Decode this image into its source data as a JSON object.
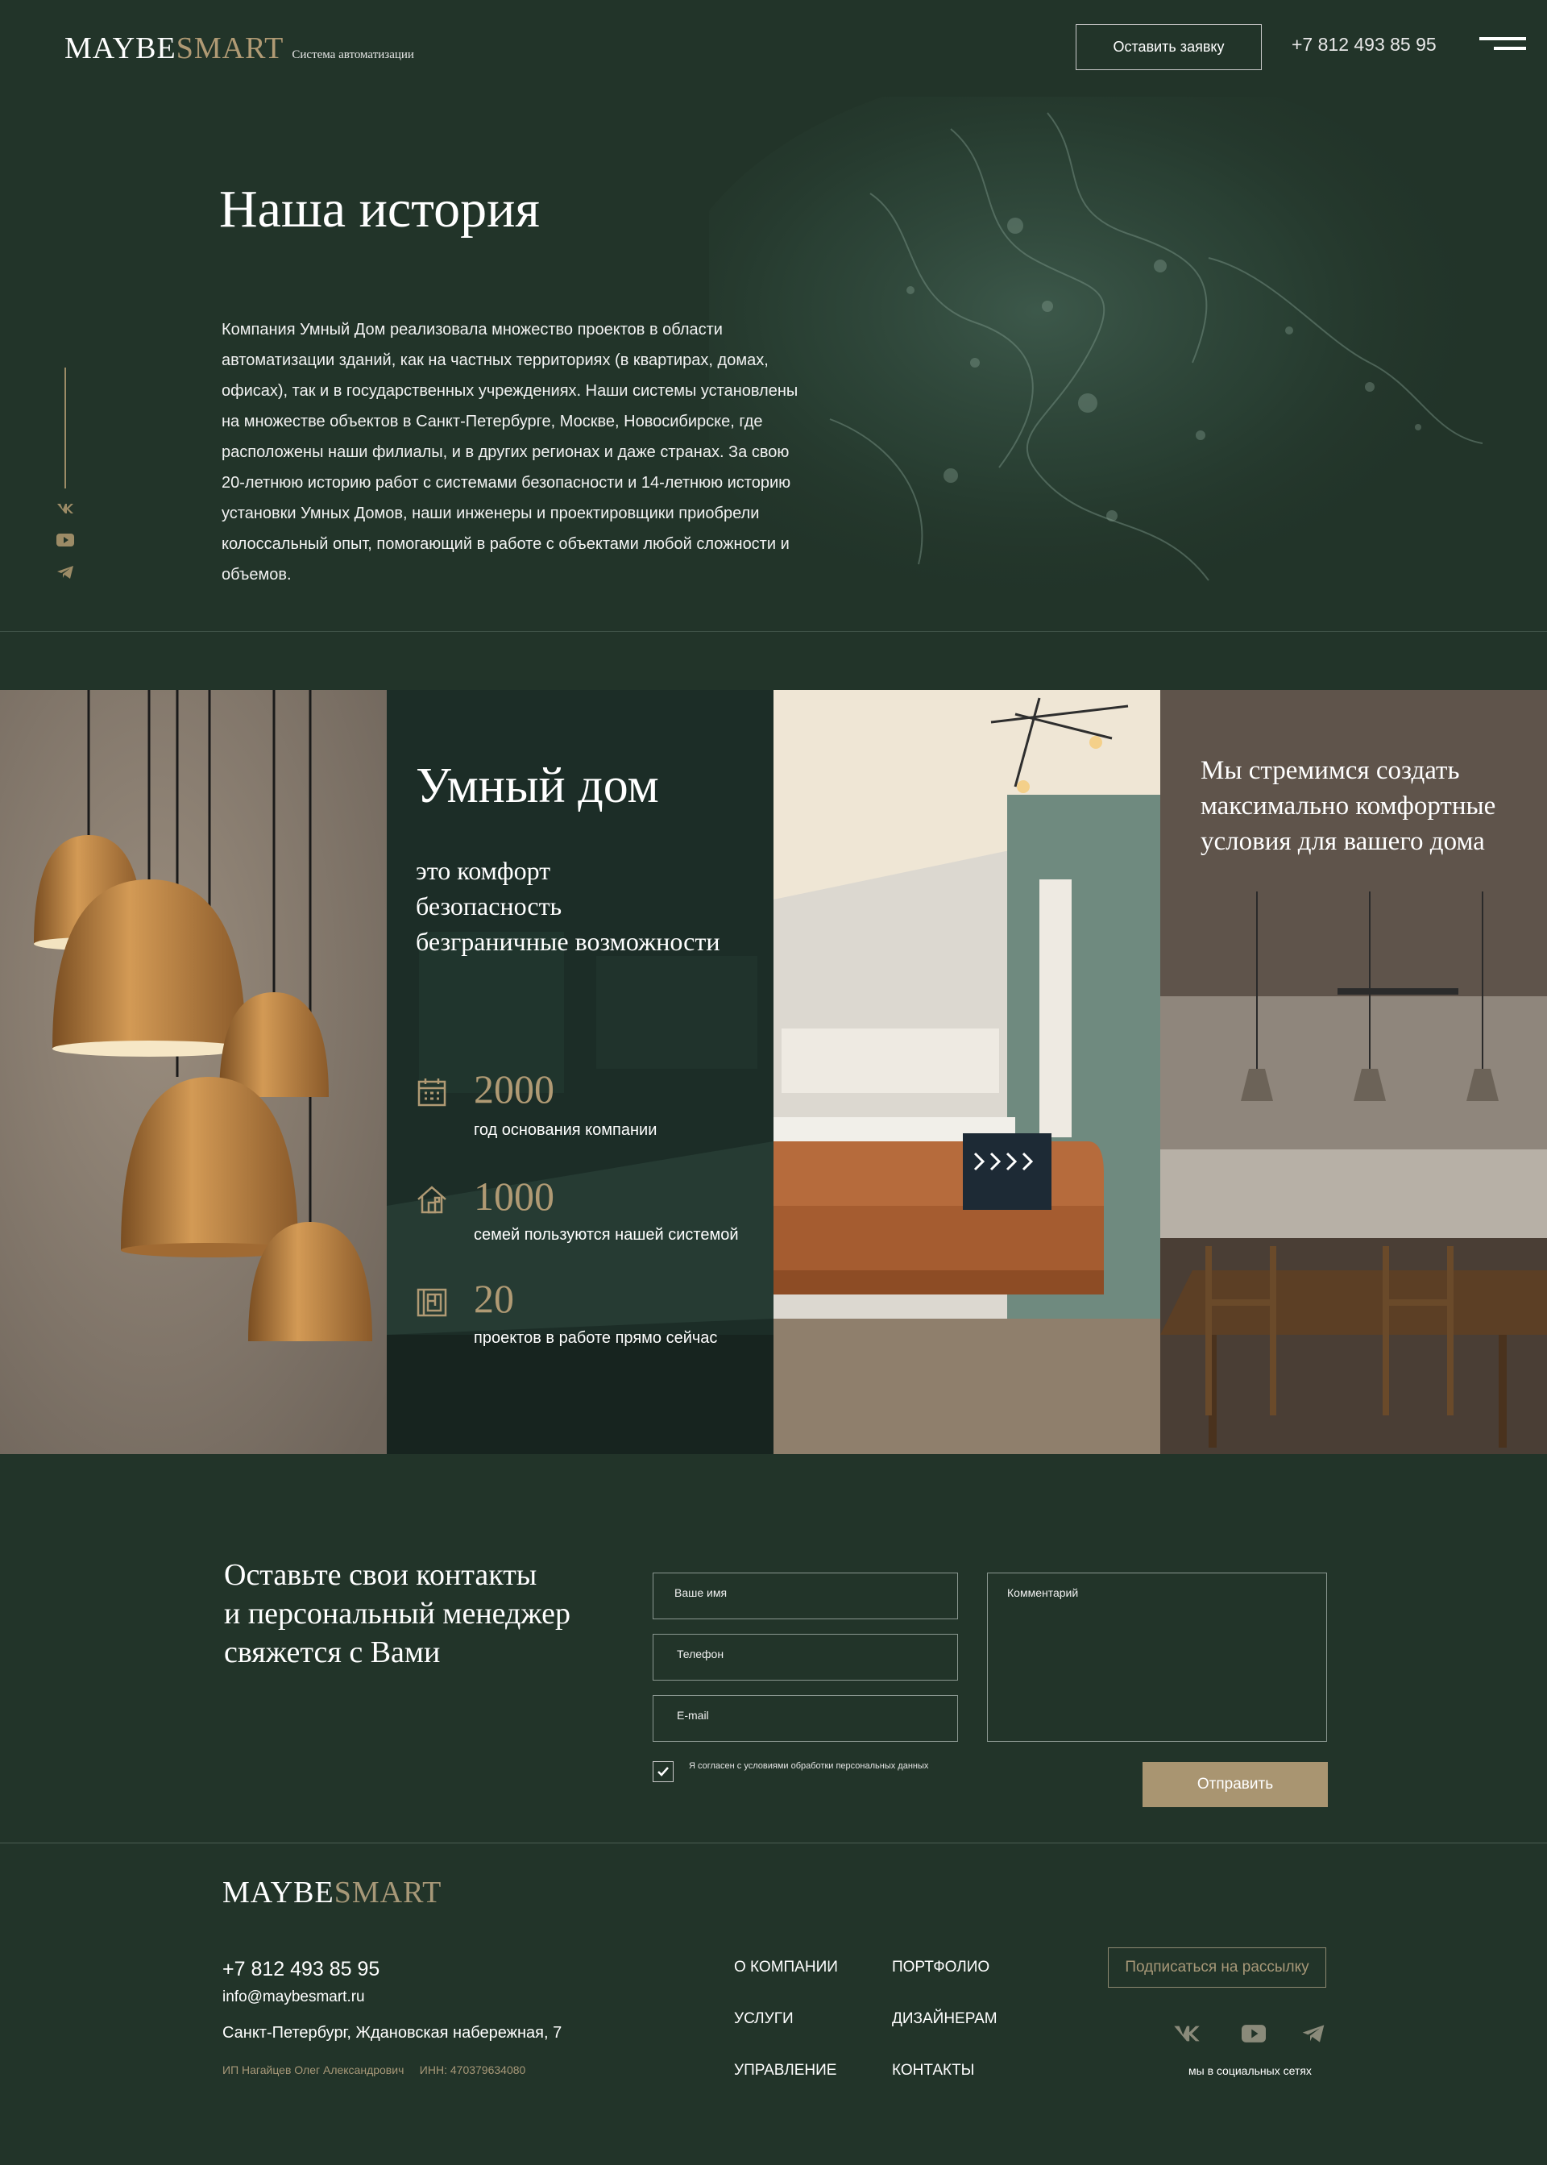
{
  "header": {
    "logo_main": "MAYBE",
    "logo_accent": "SMART",
    "logo_tagline": "Система автоматизации",
    "request_button": "Оставить заявку",
    "phone": "+7 812 493 85 95"
  },
  "history": {
    "title": "Наша история",
    "text": "Компания Умный Дом реализовала множество проектов в области автоматизации зданий, как на частных территориях (в квартирах, домах, офисах), так и в государственных учреждениях. Наши системы установлены на множестве объектов в Санкт-Петербурге, Москве, Новосибирске, где расположены наши филиалы, и в других регионах и даже странах. За свою 20-летнюю историю работ с системами безопасности и 14-летнюю историю установки Умных Домов, наши инженеры и проектировщики приобрели колоссальный опыт, помогающий в работе с объектами любой сложности и объемов."
  },
  "side_social": [
    "vk-icon",
    "youtube-icon",
    "telegram-icon"
  ],
  "smart_home": {
    "title": "Умный дом",
    "line1": "это комфорт",
    "line2": "безопасность",
    "line3": "безграничные возможности",
    "stats": [
      {
        "icon": "calendar-icon",
        "value": "2000",
        "label": "год основания компании"
      },
      {
        "icon": "house-icon",
        "value": "1000",
        "label": "семей пользуются нашей системой"
      },
      {
        "icon": "blueprint-icon",
        "value": "20",
        "label": "проектов в работе прямо сейчас"
      }
    ]
  },
  "strive_text": "Мы стремимся создать максимально комфортные условия для вашего дома",
  "contact": {
    "title_line1": "Оставьте свои контакты",
    "title_line2": "и персональный менеджер",
    "title_line3": "свяжется с Вами",
    "name_placeholder": "Ваше имя",
    "phone_placeholder": "Телефон",
    "email_placeholder": "E-mail",
    "comment_placeholder": "Комментарий",
    "consent": "Я согласен с условиями обработки персональных данных",
    "consent_checked": true,
    "submit": "Отправить"
  },
  "footer": {
    "logo_main": "MAYBE",
    "logo_accent": "SMART",
    "phone": "+7 812 493 85 95",
    "email": "info@maybesmart.ru",
    "address": "Санкт-Петербург, Ждановская набережная, 7",
    "legal": "ИП Нагайцев Олег Александрович     ИНН: 470379634080",
    "nav": {
      "about": "О КОМПАНИИ",
      "portfolio": "ПОРТФОЛИО",
      "services": "УСЛУГИ",
      "designers": "ДИЗАЙНЕРАМ",
      "management": "УПРАВЛЕНИЕ",
      "contacts": "КОНТАКТЫ"
    },
    "subscribe": "Подписаться на рассылку",
    "social_caption": "мы в социальных сетях"
  },
  "colors": {
    "background": "#223429",
    "accent_gold": "#b09a74",
    "button_gold": "#a99571"
  }
}
